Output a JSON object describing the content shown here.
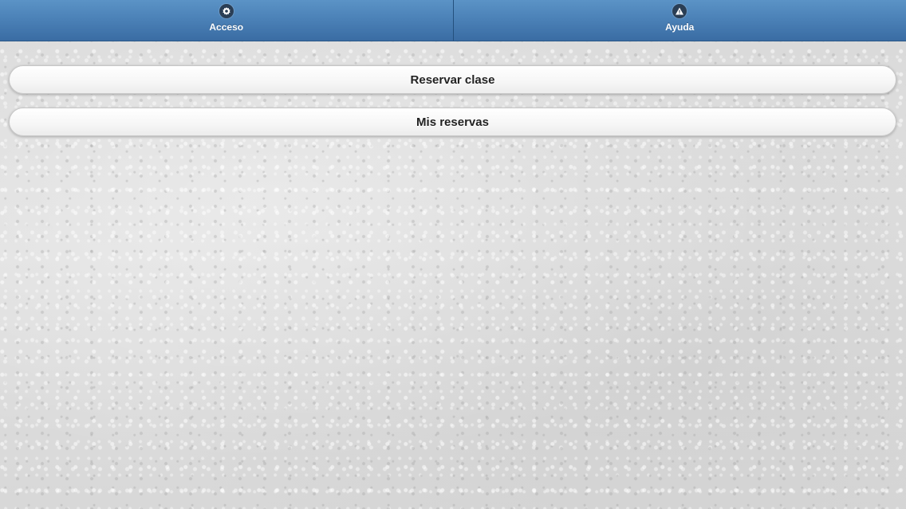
{
  "navbar": {
    "items": [
      {
        "label": "Acceso",
        "icon": "gear-icon"
      },
      {
        "label": "Ayuda",
        "icon": "alert-icon"
      }
    ]
  },
  "menu": {
    "buttons": [
      {
        "label": "Reservar clase"
      },
      {
        "label": "Mis reservas"
      }
    ]
  },
  "colors": {
    "navbar": "#4a80b6",
    "icon_bg": "#2a3e55",
    "button_text": "#222222",
    "background": "#dedede"
  }
}
